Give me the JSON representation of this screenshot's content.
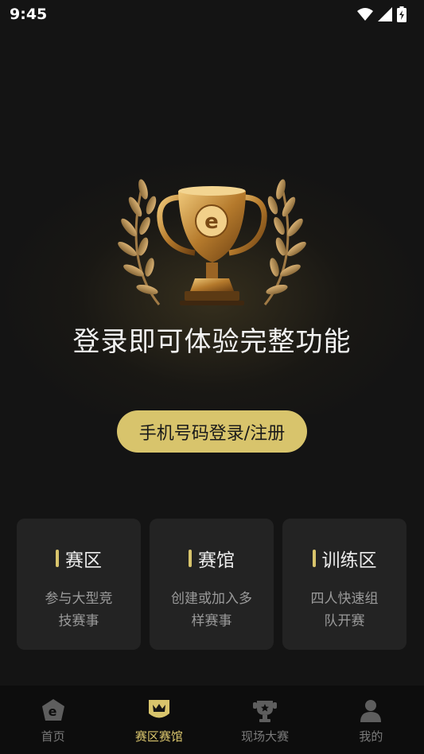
{
  "status_bar": {
    "time": "9:45",
    "icons": [
      "wifi-icon",
      "signal-icon",
      "battery-charging-icon"
    ]
  },
  "hero": {
    "trophy_icon": "trophy-icon",
    "headline": "登录即可体验完整功能"
  },
  "login_button": {
    "label": "手机号码登录/注册"
  },
  "cards": [
    {
      "title": "赛区",
      "desc_line1": "参与大型竞",
      "desc_line2": "技赛事"
    },
    {
      "title": "赛馆",
      "desc_line1": "创建或加入多",
      "desc_line2": "样赛事"
    },
    {
      "title": "训练区",
      "desc_line1": "四人快速组",
      "desc_line2": "队开赛"
    }
  ],
  "tabs": [
    {
      "label": "首页",
      "icon": "home-icon",
      "active": false
    },
    {
      "label": "赛区赛馆",
      "icon": "crown-shield-icon",
      "active": true
    },
    {
      "label": "现场大赛",
      "icon": "trophy-stage-icon",
      "active": false
    },
    {
      "label": "我的",
      "icon": "user-icon",
      "active": false
    }
  ],
  "colors": {
    "accent": "#d8c46c",
    "background": "#141414",
    "card": "#232323",
    "tabbar": "#0d0d0d"
  }
}
